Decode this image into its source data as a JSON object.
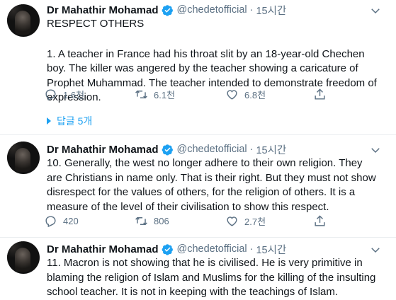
{
  "author": {
    "name": "Dr Mahathir Mohamad",
    "handle": "@chedetofficial",
    "separator": "·",
    "verified_color": "#1da1f2"
  },
  "tweets": [
    {
      "time": "15시간",
      "lines": [
        "RESPECT OTHERS",
        "",
        "1. A teacher in France had his throat slit by an 18-year-old Chechen boy. The killer was angered by the teacher showing a caricature of Prophet Muhammad. The teacher intended to demonstrate freedom of expression."
      ],
      "counts": {
        "reply": "1.6천",
        "retweet": "6.1천",
        "like": "6.8천"
      },
      "replies_link": "답글 5개"
    },
    {
      "time": "15시간",
      "lines": [
        "10. Generally, the west no longer adhere to their own religion. They are Christians in name only. That is their right. But they must not show disrespect for the values of others, for the religion of others. It is a measure of the level of their civilisation to show this respect."
      ],
      "counts": {
        "reply": "420",
        "retweet": "806",
        "like": "2.7천"
      }
    },
    {
      "time": "15시간",
      "lines": [
        "11. Macron is not showing that he is civilised. He is very primitive in blaming the religion of Islam and Muslims for the killing of the insulting school teacher. It is not in keeping with the teachings of Islam."
      ]
    }
  ],
  "icons": {
    "more": "chevron-down-icon",
    "reply": "reply-icon",
    "retweet": "retweet-icon",
    "like": "like-icon",
    "share": "share-icon"
  },
  "colors": {
    "text": "#0f1419",
    "secondary": "#5b7083",
    "accent": "#1da1f2",
    "divider": "#ebeef0"
  }
}
